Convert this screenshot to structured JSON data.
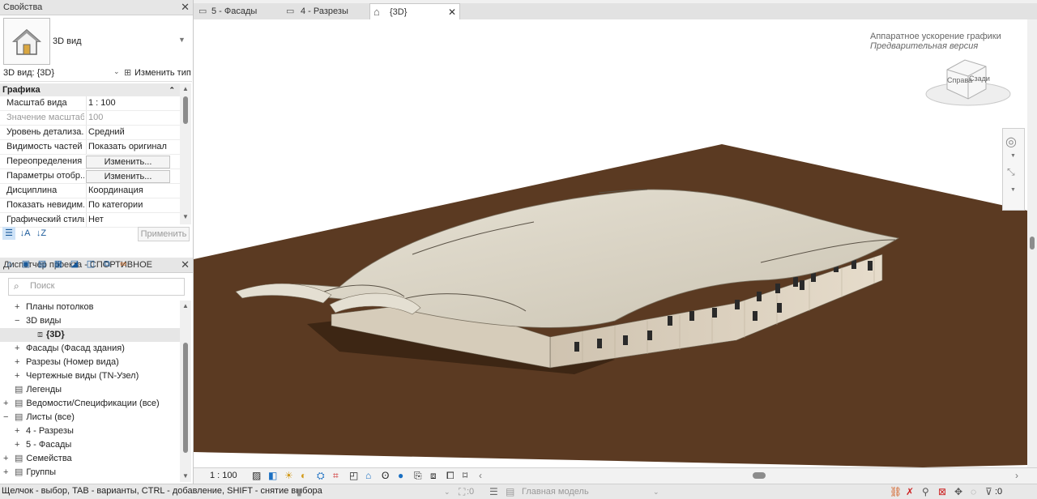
{
  "properties_panel": {
    "title": "Свойства",
    "type_name": "3D вид",
    "view_selector": "3D вид: {3D}",
    "edit_type_label": "Изменить тип",
    "group_header": "Графика",
    "rows": [
      {
        "name": "Масштаб вида",
        "value": "1 : 100"
      },
      {
        "name": "Значение масштаб...",
        "value": "100",
        "disabled": true
      },
      {
        "name": "Уровень детализа...",
        "value": "Средний"
      },
      {
        "name": "Видимость частей",
        "value": "Показать оригинал"
      },
      {
        "name": "Переопределения ...",
        "button": "Изменить..."
      },
      {
        "name": "Параметры отобр...",
        "button": "Изменить..."
      },
      {
        "name": "Дисциплина",
        "value": "Координация"
      },
      {
        "name": "Показать невидим...",
        "value": "По категории"
      },
      {
        "name": "Графический стиль...",
        "value": "Нет"
      }
    ],
    "apply_label": "Применить"
  },
  "project_browser": {
    "title": "Диспетчер проекта - СПОРТИВНОЕ",
    "search_placeholder": "Поиск",
    "tree": [
      {
        "label": "Планы потолков",
        "indent": 1,
        "toggle": "+"
      },
      {
        "label": "3D виды",
        "indent": 1,
        "toggle": "−"
      },
      {
        "label": "{3D}",
        "indent": 2,
        "toggle": "",
        "selected": true,
        "bold": true
      },
      {
        "label": "Фасады (Фасад здания)",
        "indent": 1,
        "toggle": "+"
      },
      {
        "label": "Разрезы (Номер вида)",
        "indent": 1,
        "toggle": "+"
      },
      {
        "label": "Чертежные виды (TN-Узел)",
        "indent": 1,
        "toggle": "+"
      },
      {
        "label": "Легенды",
        "indent": 0,
        "toggle": "",
        "icon": true
      },
      {
        "label": "Ведомости/Спецификации (все)",
        "indent": 0,
        "toggle": "+",
        "icon": true
      },
      {
        "label": "Листы (все)",
        "indent": 0,
        "toggle": "−",
        "icon": true
      },
      {
        "label": "4 - Разрезы",
        "indent": 1,
        "toggle": "+"
      },
      {
        "label": "5 - Фасады",
        "indent": 1,
        "toggle": "+"
      },
      {
        "label": "Семейства",
        "indent": 0,
        "toggle": "+",
        "icon": true
      },
      {
        "label": "Группы",
        "indent": 0,
        "toggle": "+",
        "icon": true
      }
    ]
  },
  "tabs": [
    {
      "label": "5 - Фасады"
    },
    {
      "label": "4 - Разрезы"
    },
    {
      "label": "{3D}",
      "active": true
    }
  ],
  "viewport": {
    "hw_accel_title": "Аппаратное ускорение графики",
    "hw_accel_subtitle": "Предварительная версия",
    "viewcube_left": "Справа",
    "viewcube_right": "Сзади"
  },
  "view_control_bar": {
    "scale": "1 : 100"
  },
  "status_bar": {
    "hint": "Щелчок - выбор, TAB - варианты, CTRL - добавление, SHIFT - снятие выбора",
    "worksets_count": ":0",
    "model_selector": "Главная модель",
    "filter_count": ":0"
  },
  "colors": {
    "ground": "#5b3a22",
    "roof": "#dcd6c8",
    "accent": "#1a5a9a"
  }
}
